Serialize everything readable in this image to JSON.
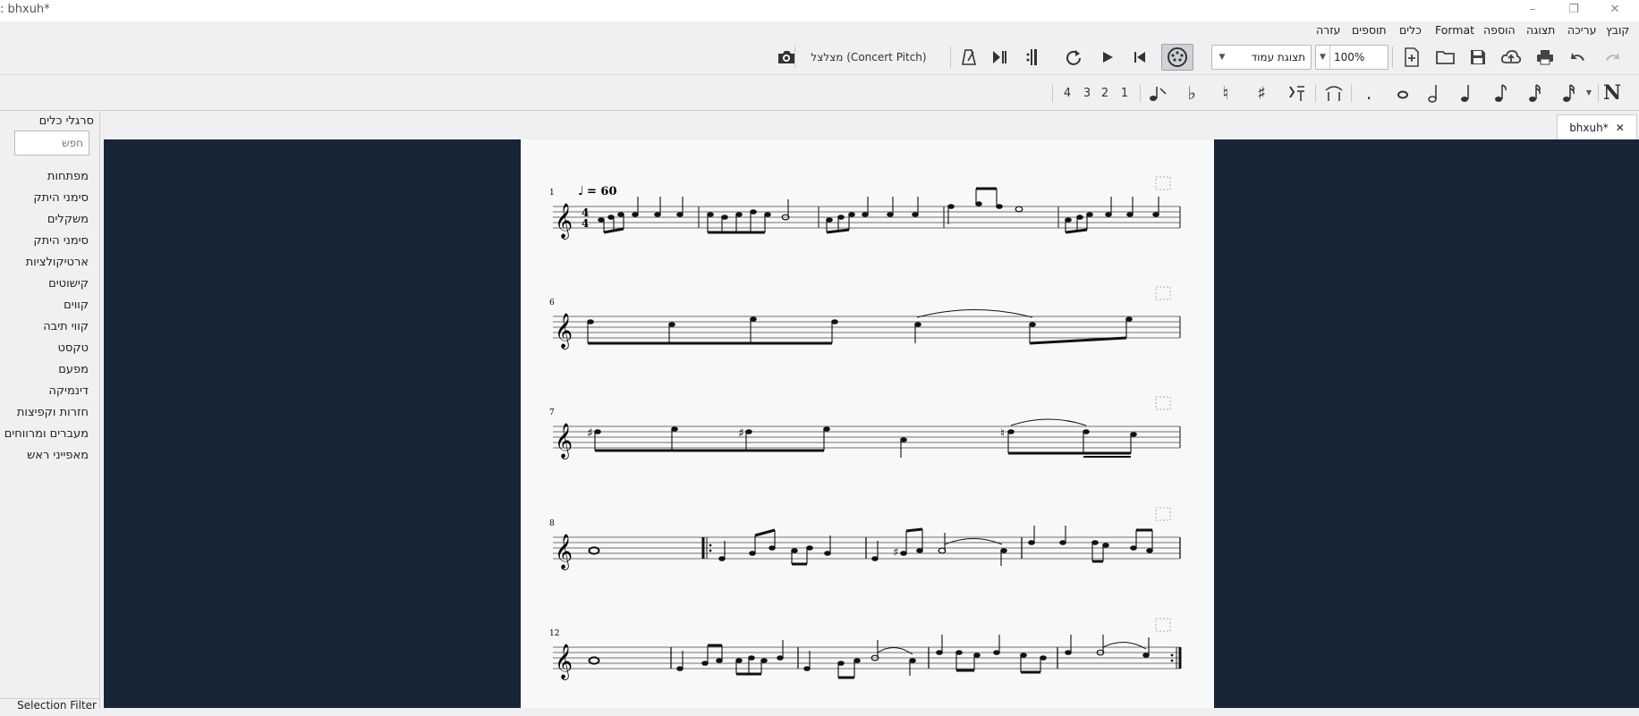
{
  "window": {
    "title": ": bhxuh*",
    "controls": [
      "–",
      "❐",
      "✕"
    ]
  },
  "menu": [
    {
      "id": "file",
      "label": "קובץ"
    },
    {
      "id": "edit",
      "label": "עריכה"
    },
    {
      "id": "view",
      "label": "תצוגה"
    },
    {
      "id": "add",
      "label": "הוספה"
    },
    {
      "id": "format",
      "label": "Format"
    },
    {
      "id": "tools",
      "label": "כלים"
    },
    {
      "id": "plugins",
      "label": "תוספים"
    },
    {
      "id": "help",
      "label": "עזרה"
    }
  ],
  "toolbar": {
    "zoom_value": "100%",
    "view_mode": "תצוגת עמוד",
    "concert_pitch": "מצלצל (Concert Pitch)"
  },
  "voices": [
    "1",
    "2",
    "3",
    "4"
  ],
  "palettes": {
    "title": "סרגלי כלים",
    "search_placeholder": "חפש",
    "items": [
      "מפתחות",
      "סימני היתק",
      "משקלים",
      "סימני היתק",
      "ארטיקולציות",
      "קישוטים",
      "קווים",
      "קווי תיבה",
      "טקסט",
      "מפעם",
      "דינמיקה",
      "חזרות וקפיצות",
      "מעברים ומרווחים",
      "מאפייני ראש"
    ],
    "selection_filter": "Selection Filter"
  },
  "tab": {
    "label": "bhxuh*",
    "close": "✕"
  },
  "score": {
    "tempo": "= 60",
    "time_sig_top": "4",
    "time_sig_bottom": "4",
    "measure_numbers": [
      "1",
      "6",
      "7",
      "8",
      "12"
    ]
  },
  "colors": {
    "canvas": "#172536",
    "page": "#f7f8f8",
    "chrome": "#f0f0f0"
  }
}
